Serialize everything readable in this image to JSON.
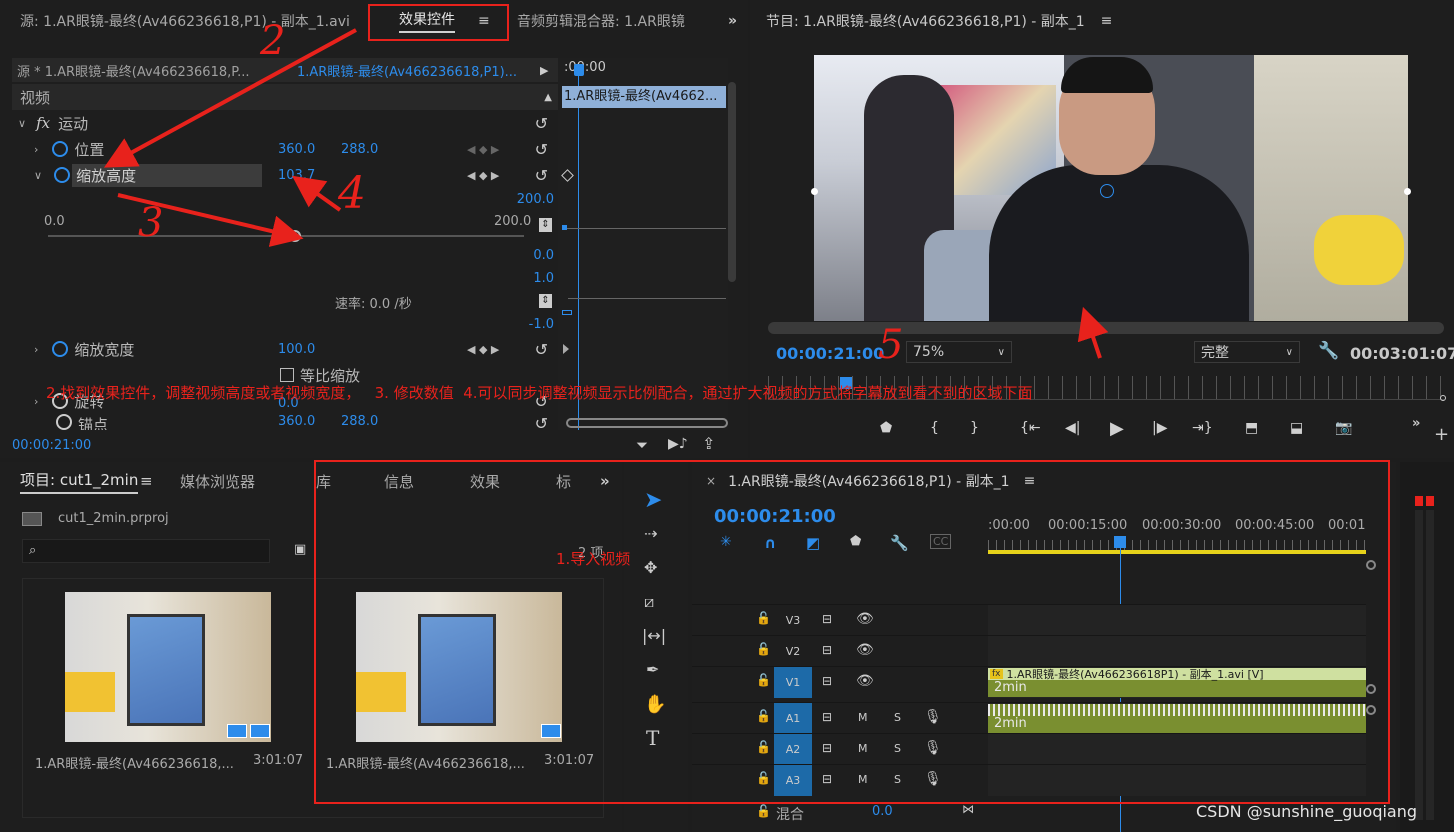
{
  "source_panel": {
    "tab_source": "源: 1.AR眼镜-最终(Av466236618,P1) - 副本_1.avi",
    "tab_effects": "效果控件",
    "tab_audio_mixer": "音频剪辑混合器: 1.AR眼镜",
    "clip_master": "源 * 1.AR眼镜-最终(Av466236618,P...",
    "clip_sequence": "1.AR眼镜-最终(Av466236618,P1)...",
    "ruler_time": ":00:00",
    "clip_bar_label": "1.AR眼镜-最终(Av4662...",
    "section_video": "视频",
    "motion_label": "运动",
    "fx_label": "fx",
    "position_label": "位置",
    "position_x": "360.0",
    "position_y": "288.0",
    "scale_height_label": "缩放高度",
    "scale_height_value": "103.7",
    "slider_min": "0.0",
    "slider_max": "200.0",
    "slider_value": 0.5185,
    "graph_top": "200.0",
    "graph_mid": "0.0",
    "graph_rate_top": "1.0",
    "graph_rate_bottom": "-1.0",
    "rate_label": "速率: 0.0 /秒",
    "scale_width_label": "缩放宽度",
    "scale_width_value": "100.0",
    "uniform_scale_label": "等比缩放",
    "rotation_label": "旋转",
    "rotation_value": "0.0",
    "anchor_label": "锚点",
    "anchor_x": "360.0",
    "anchor_y": "288.0",
    "footer_time": "00:00:21:00"
  },
  "program_panel": {
    "title": "节目: 1.AR眼镜-最终(Av466236618,P1) - 副本_1",
    "timecode": "00:00:21:00",
    "zoom": "75%",
    "quality": "完整",
    "duration": "00:03:01:07",
    "playhead_position": 0.115
  },
  "project_panel": {
    "tab_project": "项目: cut1_2min",
    "tab_media_browser": "媒体浏览器",
    "tab_library": "库",
    "tab_info": "信息",
    "tab_effects": "效果",
    "tab_markers": "标",
    "project_file": "cut1_2min.prproj",
    "item_count": "2 项",
    "items": [
      {
        "name": "1.AR眼镜-最终(Av466236618,...",
        "duration": "3:01:07"
      },
      {
        "name": "1.AR眼镜-最终(Av466236618,...",
        "duration": "3:01:07"
      }
    ]
  },
  "timeline_panel": {
    "title": "1.AR眼镜-最终(Av466236618,P1) - 副本_1",
    "timecode": "00:00:21:00",
    "ruler_labels": [
      ":00:00",
      "00:00:15:00",
      "00:00:30:00",
      "00:00:45:00",
      "00:01"
    ],
    "tracks": [
      {
        "name": "V3",
        "type": "video"
      },
      {
        "name": "V2",
        "type": "video"
      },
      {
        "name": "V1",
        "type": "video"
      },
      {
        "name": "A1",
        "type": "audio"
      },
      {
        "name": "A2",
        "type": "audio"
      },
      {
        "name": "A3",
        "type": "audio"
      }
    ],
    "video_clip_label": "1.AR眼镜-最终(Av466236618P1) - 副本_1.avi [V]",
    "clip_duration_label": "2min",
    "mix_label": "混合",
    "mix_value": "0.0",
    "mute_label": "M",
    "solo_label": "S",
    "fx_badge": "fx"
  },
  "annotations": {
    "step2": "2",
    "step3": "3",
    "step4": "4",
    "step5": "5",
    "caption": "2.找到效果控件，调整视频高度或者视频宽度，   3. 修改数值  4.可以同步调整视频显示比例配合，通过扩大视频的方式将字幕放到看不到的区域下面",
    "step1": "1.导入视频",
    "color": "#e8221c"
  },
  "watermark": "CSDN @sunshine_guoqiang"
}
